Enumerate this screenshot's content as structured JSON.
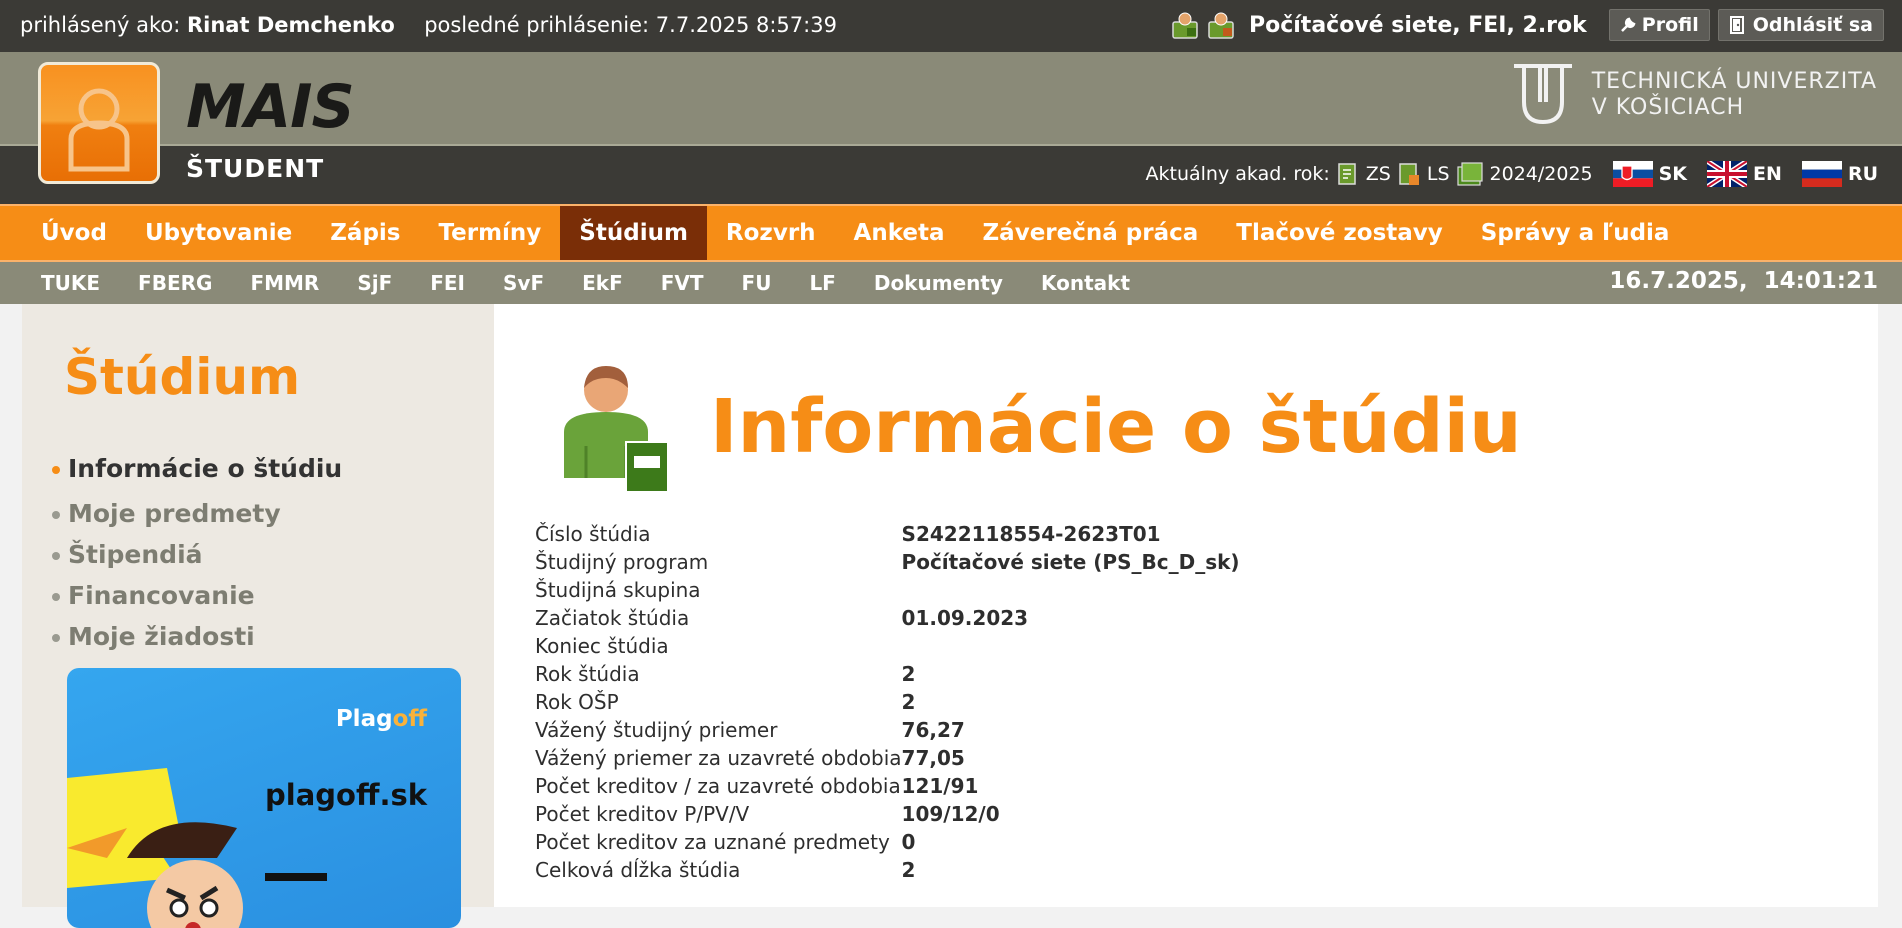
{
  "topbar": {
    "logged_as_label": "prihlásený ako:",
    "user_name": "Rinat Demchenko",
    "last_login_label": "posledné prihlásenie:",
    "last_login_value": "7.7.2025 8:57:39",
    "program": "Počítačové siete, FEI, 2.rok",
    "profile_label": "Profil",
    "logout_label": "Odhlásiť sa"
  },
  "header": {
    "logo_text": "MAIS",
    "subtitle": "ŠTUDENT",
    "university_line1": "TECHNICKÁ UNIVERZITA",
    "university_line2": "V KOŠICIACH",
    "akad_label": "Aktuálny akad. rok:",
    "zs": "ZS",
    "ls": "LS",
    "year": "2024/2025",
    "languages": [
      "SK",
      "EN",
      "RU"
    ]
  },
  "main_nav": [
    "Úvod",
    "Ubytovanie",
    "Zápis",
    "Termíny",
    "Štúdium",
    "Rozvrh",
    "Anketa",
    "Záverečná práca",
    "Tlačové zostavy",
    "Správy a ľudia"
  ],
  "main_nav_active": "Štúdium",
  "sub_nav": [
    "TUKE",
    "FBERG",
    "FMMR",
    "SjF",
    "FEI",
    "SvF",
    "EkF",
    "FVT",
    "FU",
    "LF",
    "Dokumenty",
    "Kontakt"
  ],
  "datetime": "16.7.2025,  14:01:21",
  "sidebar": {
    "title": "Štúdium",
    "items": [
      "Informácie o štúdiu",
      "Moje predmety",
      "Štipendiá",
      "Financovanie",
      "Moje žiadosti"
    ],
    "active_index": 0,
    "ad": {
      "brand_a": "Plag",
      "brand_b": "off",
      "domain": "plagoff.sk"
    }
  },
  "content": {
    "title": "Informácie o štúdiu",
    "rows": [
      {
        "label": "Číslo štúdia",
        "value": "S2422118554-2623T01"
      },
      {
        "label": "Študijný program",
        "value": "Počítačové siete (PS_Bc_D_sk)"
      },
      {
        "label": "Študijná skupina",
        "value": ""
      },
      {
        "label": "Začiatok štúdia",
        "value": "01.09.2023"
      },
      {
        "label": "Koniec štúdia",
        "value": ""
      },
      {
        "label": "Rok štúdia",
        "value": "2"
      },
      {
        "label": "Rok OŠP",
        "value": "2"
      },
      {
        "label": "Vážený študijný priemer",
        "value": "76,27"
      },
      {
        "label": "Vážený priemer za uzavreté obdobia",
        "value": "77,05"
      },
      {
        "label": "Počet kreditov / za uzavreté obdobia",
        "value": "121/91"
      },
      {
        "label": "Počet kreditov P/PV/V",
        "value": "109/12/0"
      },
      {
        "label": "Počet kreditov za uznané predmety",
        "value": "0"
      },
      {
        "label": "Celková dĺžka štúdia",
        "value": "2"
      }
    ]
  },
  "colors": {
    "orange": "#f68d16",
    "dark": "#3b3a36",
    "olive": "#8a8a78",
    "active_nav": "#7a2e07"
  }
}
